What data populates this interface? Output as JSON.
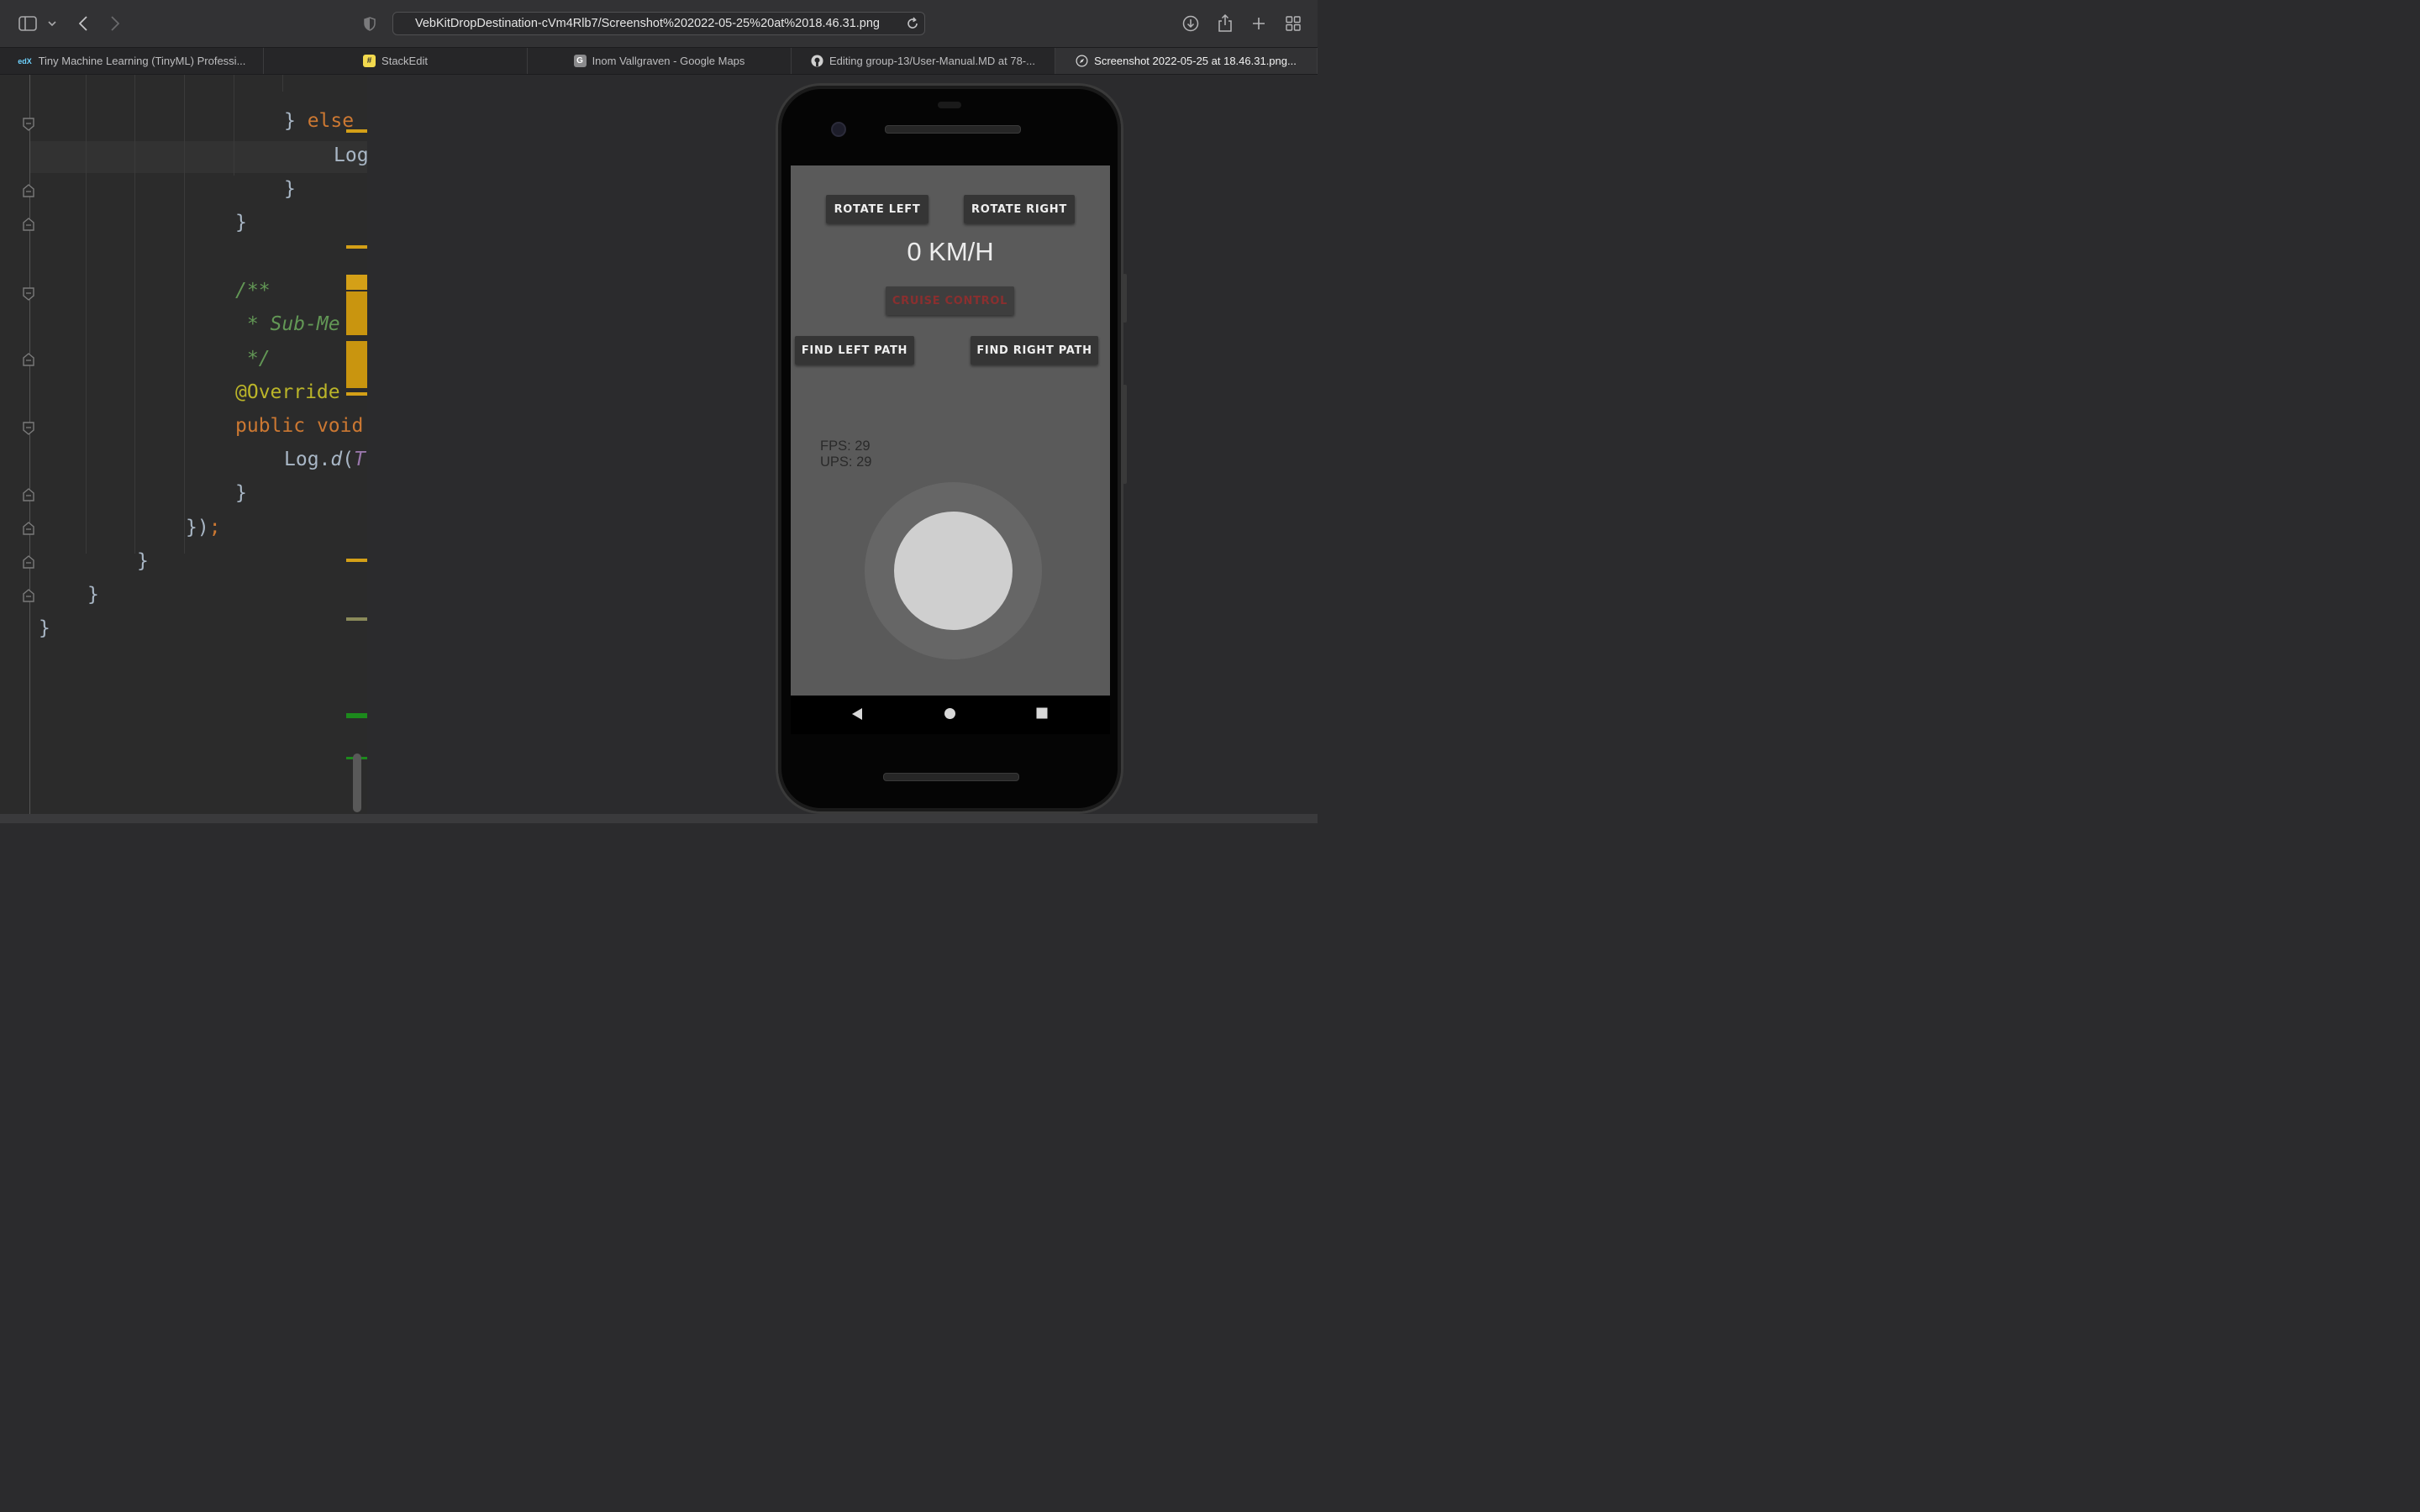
{
  "browser": {
    "url": "VebKitDropDestination-cVm4Rlb7/Screenshot%202022-05-25%20at%2018.46.31.png",
    "tabs": [
      {
        "label": "Tiny Machine Learning (TinyML) Professi...",
        "favicon": "edx",
        "active": false
      },
      {
        "label": "StackEdit",
        "favicon": "#",
        "active": false
      },
      {
        "label": "Inom Vallgraven - Google Maps",
        "favicon": "G",
        "active": false
      },
      {
        "label": "Editing group-13/User-Manual.MD at 78-...",
        "favicon": "github",
        "active": false
      },
      {
        "label": "Screenshot 2022-05-25 at 18.46.31.png...",
        "favicon": "compass",
        "active": true
      }
    ]
  },
  "editor": {
    "lines": {
      "l1a": "} ",
      "l1b": "else",
      "l2": "Log",
      "l3": "}",
      "l4": "}",
      "l5": "/**",
      "l6": " * Sub-Me",
      "l7": " */",
      "l8": "@Override",
      "l9a": "public ",
      "l9b": "void",
      "l10a": "Log.",
      "l10b": "d",
      "l10c": "(",
      "l10d": "T",
      "l11": "}",
      "l12a": "})",
      "l12b": ";",
      "l13": "}",
      "l14": "}",
      "l15": "}"
    }
  },
  "app": {
    "rotate_left": "ROTATE LEFT",
    "rotate_right": "ROTATE RIGHT",
    "speed": "0 KM/H",
    "cruise_control": "CRUISE CONTROL",
    "find_left_path": "FIND LEFT PATH",
    "find_right_path": "FIND RIGHT PATH",
    "fps": "FPS: 29",
    "ups": "UPS: 29"
  },
  "colors": {
    "accent_orange": "#cc7832",
    "comment_green": "#629755",
    "annotation_yellow": "#bbb529",
    "marker_yellow": "#d4a017",
    "cruise_text": "#8a2f2f"
  }
}
